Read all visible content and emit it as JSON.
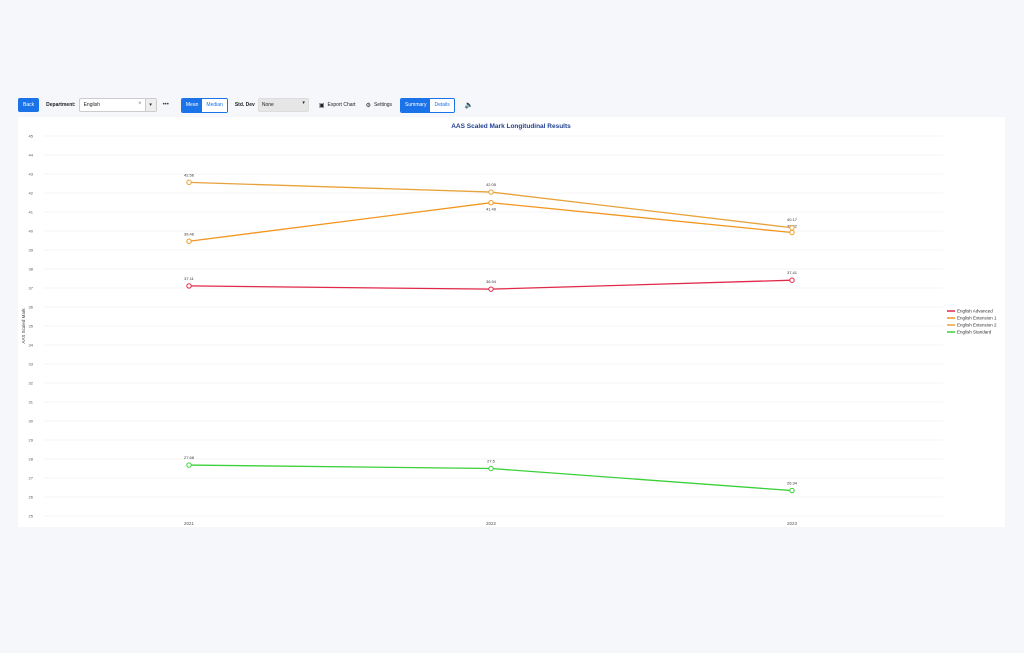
{
  "toolbar": {
    "back_label": "Back",
    "department_label": "Department:",
    "department_value": "English",
    "clear_glyph": "×",
    "caret_glyph": "▾",
    "more_glyph": "•••",
    "mean_label": "Mean",
    "median_label": "Median",
    "stddev_label": "Std. Dev",
    "stddev_value": "None",
    "export_label": "Export Chart",
    "settings_label": "Settings",
    "summary_label": "Summary",
    "details_label": "Details",
    "export_icon": "image-icon",
    "settings_icon": "gear-icon",
    "audio_icon": "speaker-icon"
  },
  "chart_data": {
    "type": "line",
    "title": "AAS Scaled Mark Longitudinal Results",
    "ylabel": "AAS Scaled Mark",
    "xlabel": "",
    "x": [
      "2021",
      "2022",
      "2023"
    ],
    "ylim": [
      25,
      45
    ],
    "yticks": [
      25,
      26,
      27,
      28,
      29,
      30,
      31,
      32,
      33,
      34,
      35,
      36,
      37,
      38,
      39,
      40,
      41,
      42,
      43,
      44,
      45
    ],
    "grid": true,
    "legend": "right",
    "series": [
      {
        "name": "English Advanced",
        "color": "#e0294a",
        "values": [
          37.11,
          36.94,
          37.41
        ],
        "labels": [
          "37.11",
          "36.94",
          "37.41"
        ]
      },
      {
        "name": "English Extension 1",
        "color": "#f2961f",
        "values": [
          39.46,
          41.49,
          39.92
        ],
        "labels": [
          "39.46",
          "41.49",
          "39.92"
        ]
      },
      {
        "name": "English Extension 2",
        "color": "#e8a23a",
        "values": [
          42.56,
          42.05,
          40.17
        ],
        "labels": [
          "42.56",
          "42.05",
          "40.17"
        ]
      },
      {
        "name": "English Standard",
        "color": "#3ad13a",
        "values": [
          27.68,
          27.5,
          26.34
        ],
        "labels": [
          "27.68",
          "27.5",
          "26.34"
        ]
      }
    ]
  }
}
